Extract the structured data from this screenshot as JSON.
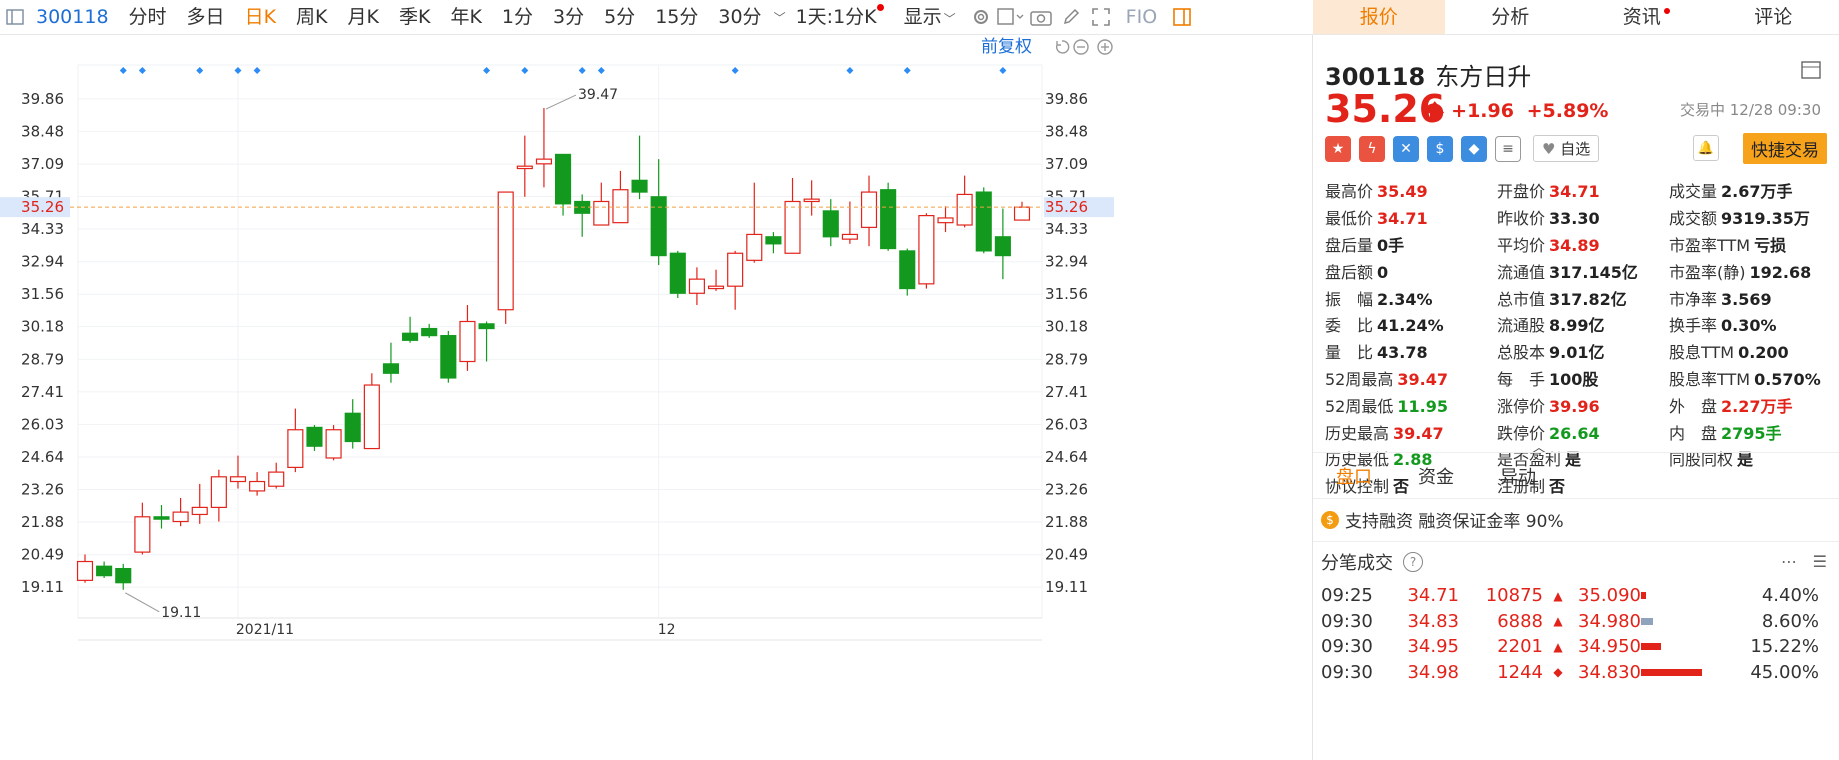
{
  "toolbar": {
    "stock_code": "300118",
    "periods": [
      "分时",
      "多日",
      "日K",
      "周K",
      "月K",
      "季K",
      "年K",
      "1分",
      "3分",
      "5分",
      "15分",
      "30分"
    ],
    "active_period": "日K",
    "interval_label": "1天:1分K",
    "display_label": "显示",
    "fio_label": "FIO",
    "restore_label": "前复权"
  },
  "right_tabs": [
    "报价",
    "分析",
    "资讯",
    "评论"
  ],
  "chart_data": {
    "type": "candlestick",
    "y_ticks": [
      "39.86",
      "38.48",
      "37.09",
      "35.71",
      "34.33",
      "32.94",
      "31.56",
      "30.18",
      "28.79",
      "27.41",
      "26.03",
      "24.64",
      "23.26",
      "21.88",
      "20.49",
      "19.11"
    ],
    "ylim": [
      17.8,
      41.3
    ],
    "x_labels": [
      "2021/11",
      "12"
    ],
    "current_price": "35.26",
    "high_annotation": "39.47",
    "low_annotation": "19.11",
    "up_color": "#e2231a",
    "down_color": "#139a1e",
    "candles": [
      {
        "o": 19.4,
        "c": 20.2,
        "h": 20.5,
        "l": 19.3
      },
      {
        "o": 20.0,
        "c": 19.6,
        "h": 20.2,
        "l": 19.5
      },
      {
        "o": 19.9,
        "c": 19.3,
        "h": 20.1,
        "l": 19.0
      },
      {
        "o": 20.6,
        "c": 22.1,
        "h": 22.7,
        "l": 20.5
      },
      {
        "o": 22.1,
        "c": 22.0,
        "h": 22.6,
        "l": 21.6
      },
      {
        "o": 21.9,
        "c": 22.3,
        "h": 22.9,
        "l": 21.7
      },
      {
        "o": 22.2,
        "c": 22.5,
        "h": 23.5,
        "l": 21.8
      },
      {
        "o": 22.5,
        "c": 23.8,
        "h": 24.1,
        "l": 21.9
      },
      {
        "o": 23.6,
        "c": 23.8,
        "h": 24.7,
        "l": 23.3
      },
      {
        "o": 23.2,
        "c": 23.6,
        "h": 24.0,
        "l": 23.0
      },
      {
        "o": 23.4,
        "c": 24.0,
        "h": 24.4,
        "l": 23.3
      },
      {
        "o": 24.2,
        "c": 25.8,
        "h": 26.7,
        "l": 24.0
      },
      {
        "o": 25.9,
        "c": 25.1,
        "h": 26.0,
        "l": 24.9
      },
      {
        "o": 24.6,
        "c": 25.8,
        "h": 26.0,
        "l": 24.5
      },
      {
        "o": 26.5,
        "c": 25.3,
        "h": 27.1,
        "l": 25.0
      },
      {
        "o": 25.0,
        "c": 27.7,
        "h": 28.2,
        "l": 25.0
      },
      {
        "o": 28.6,
        "c": 28.2,
        "h": 29.5,
        "l": 27.8
      },
      {
        "o": 29.9,
        "c": 29.6,
        "h": 30.6,
        "l": 29.5
      },
      {
        "o": 30.1,
        "c": 29.8,
        "h": 30.3,
        "l": 29.7
      },
      {
        "o": 29.8,
        "c": 28.0,
        "h": 30.0,
        "l": 27.8
      },
      {
        "o": 28.7,
        "c": 30.4,
        "h": 31.1,
        "l": 28.3
      },
      {
        "o": 30.3,
        "c": 30.1,
        "h": 30.4,
        "l": 28.7
      },
      {
        "o": 30.9,
        "c": 35.9,
        "h": 35.9,
        "l": 30.3
      },
      {
        "o": 36.9,
        "c": 37.0,
        "h": 38.3,
        "l": 35.7
      },
      {
        "o": 37.1,
        "c": 37.3,
        "h": 39.47,
        "l": 36.1
      },
      {
        "o": 37.5,
        "c": 35.4,
        "h": 37.5,
        "l": 34.9
      },
      {
        "o": 35.5,
        "c": 35.0,
        "h": 35.8,
        "l": 34.0
      },
      {
        "o": 34.5,
        "c": 35.5,
        "h": 36.3,
        "l": 34.5
      },
      {
        "o": 34.6,
        "c": 36.0,
        "h": 36.8,
        "l": 34.6
      },
      {
        "o": 36.4,
        "c": 35.9,
        "h": 38.3,
        "l": 35.6
      },
      {
        "o": 35.7,
        "c": 33.2,
        "h": 37.3,
        "l": 32.8
      },
      {
        "o": 33.3,
        "c": 31.6,
        "h": 33.4,
        "l": 31.4
      },
      {
        "o": 31.6,
        "c": 32.2,
        "h": 32.7,
        "l": 31.1
      },
      {
        "o": 31.8,
        "c": 31.9,
        "h": 32.6,
        "l": 31.7
      },
      {
        "o": 31.9,
        "c": 33.3,
        "h": 33.4,
        "l": 30.9
      },
      {
        "o": 33.0,
        "c": 34.1,
        "h": 36.3,
        "l": 32.9
      },
      {
        "o": 34.0,
        "c": 33.7,
        "h": 34.2,
        "l": 33.3
      },
      {
        "o": 33.3,
        "c": 35.5,
        "h": 36.5,
        "l": 33.3
      },
      {
        "o": 35.5,
        "c": 35.6,
        "h": 36.4,
        "l": 34.9
      },
      {
        "o": 35.1,
        "c": 34.0,
        "h": 35.6,
        "l": 33.6
      },
      {
        "o": 33.9,
        "c": 34.1,
        "h": 35.5,
        "l": 33.7
      },
      {
        "o": 34.4,
        "c": 35.9,
        "h": 36.6,
        "l": 33.6
      },
      {
        "o": 36.0,
        "c": 33.5,
        "h": 36.3,
        "l": 33.4
      },
      {
        "o": 33.4,
        "c": 31.8,
        "h": 33.5,
        "l": 31.5
      },
      {
        "o": 32.0,
        "c": 34.9,
        "h": 35.0,
        "l": 31.8
      },
      {
        "o": 34.6,
        "c": 34.8,
        "h": 35.3,
        "l": 34.2
      },
      {
        "o": 34.5,
        "c": 35.8,
        "h": 36.6,
        "l": 34.4
      },
      {
        "o": 35.9,
        "c": 33.4,
        "h": 36.1,
        "l": 33.3
      },
      {
        "o": 34.0,
        "c": 33.2,
        "h": 35.2,
        "l": 32.2
      },
      {
        "o": 34.71,
        "c": 35.26,
        "h": 35.49,
        "l": 34.71
      }
    ],
    "event_marker_indexes": [
      2,
      3,
      6,
      8,
      9,
      21,
      23,
      26,
      27,
      34,
      40,
      43,
      48
    ]
  },
  "quote": {
    "code": "300118",
    "name": "东方日升",
    "price": "35.26",
    "change": "+1.96",
    "change_pct": "+5.89%",
    "status": "交易中 12/28 09:30",
    "watch_label": "自选",
    "fast_trade_label": "快捷交易",
    "rows": [
      [
        {
          "label": "最高价",
          "value": "35.49",
          "color": "red"
        },
        {
          "label": "开盘价",
          "value": "34.71",
          "color": "red"
        },
        {
          "label": "成交量",
          "value": "2.67万手",
          "color": "dark"
        }
      ],
      [
        {
          "label": "最低价",
          "value": "34.71",
          "color": "red"
        },
        {
          "label": "昨收价",
          "value": "33.30",
          "color": "dark"
        },
        {
          "label": "成交额",
          "value": "9319.35万",
          "color": "dark"
        }
      ],
      [
        {
          "label": "盘后量",
          "value": "0手",
          "color": "dark"
        },
        {
          "label": "平均价",
          "value": "34.89",
          "color": "red"
        },
        {
          "label": "市盈率TTM",
          "value": "亏损",
          "color": "dark"
        }
      ],
      [
        {
          "label": "盘后额",
          "value": "0",
          "color": "dark"
        },
        {
          "label": "流通值",
          "value": "317.145亿",
          "color": "dark"
        },
        {
          "label": "市盈率(静)",
          "value": "192.68",
          "color": "dark"
        }
      ],
      [
        {
          "label": "振　幅",
          "value": "2.34%",
          "color": "dark"
        },
        {
          "label": "总市值",
          "value": "317.82亿",
          "color": "dark"
        },
        {
          "label": "市净率",
          "value": "3.569",
          "color": "dark"
        }
      ],
      [
        {
          "label": "委　比",
          "value": "41.24%",
          "color": "dark"
        },
        {
          "label": "流通股",
          "value": "8.99亿",
          "color": "dark"
        },
        {
          "label": "换手率",
          "value": "0.30%",
          "color": "dark"
        }
      ],
      [
        {
          "label": "量　比",
          "value": "43.78",
          "color": "dark"
        },
        {
          "label": "总股本",
          "value": "9.01亿",
          "color": "dark"
        },
        {
          "label": "股息TTM",
          "value": "0.200",
          "color": "dark"
        }
      ],
      [
        {
          "label": "52周最高",
          "value": "39.47",
          "color": "red"
        },
        {
          "label": "每　手",
          "value": "100股",
          "color": "dark"
        },
        {
          "label": "股息率TTM",
          "value": "0.570%",
          "color": "dark"
        }
      ],
      [
        {
          "label": "52周最低",
          "value": "11.95",
          "color": "green"
        },
        {
          "label": "涨停价",
          "value": "39.96",
          "color": "red"
        },
        {
          "label": "外　盘",
          "value": "2.27万手",
          "color": "red"
        }
      ],
      [
        {
          "label": "历史最高",
          "value": "39.47",
          "color": "red"
        },
        {
          "label": "跌停价",
          "value": "26.64",
          "color": "green"
        },
        {
          "label": "内　盘",
          "value": "2795手",
          "color": "green"
        }
      ],
      [
        {
          "label": "历史最低",
          "value": "2.88",
          "color": "green"
        },
        {
          "label": "是否盈利",
          "value": "是",
          "color": "dark"
        },
        {
          "label": "同股同权",
          "value": "是",
          "color": "dark"
        }
      ],
      [
        {
          "label": "协议控制",
          "value": "否",
          "color": "dark"
        },
        {
          "label": "注册制",
          "value": "否",
          "color": "dark"
        },
        {
          "label": "",
          "value": "",
          "color": "dark"
        }
      ]
    ],
    "sub_tabs": [
      "盘口",
      "资金",
      "异动"
    ],
    "margin_text": "支持融资 融资保证金率 90%",
    "ticks_title": "分笔成交",
    "ticks": [
      {
        "time": "09:25",
        "price": "34.71",
        "vol": "10875",
        "dir": "▲",
        "avg": "35.090",
        "pct": "4.40%",
        "bar": 0.04,
        "barcolor": "#e2231a"
      },
      {
        "time": "09:30",
        "price": "34.83",
        "vol": "6888",
        "dir": "▲",
        "avg": "34.980",
        "pct": "8.60%",
        "bar": 0.09,
        "barcolor": "#8fa3bd"
      },
      {
        "time": "09:30",
        "price": "34.95",
        "vol": "2201",
        "dir": "▲",
        "avg": "34.950",
        "pct": "15.22%",
        "bar": 0.15,
        "barcolor": "#e2231a"
      },
      {
        "time": "09:30",
        "price": "34.98",
        "vol": "1244",
        "dir": "◆",
        "avg": "34.830",
        "pct": "45.00%",
        "bar": 0.45,
        "barcolor": "#e2231a"
      }
    ]
  }
}
